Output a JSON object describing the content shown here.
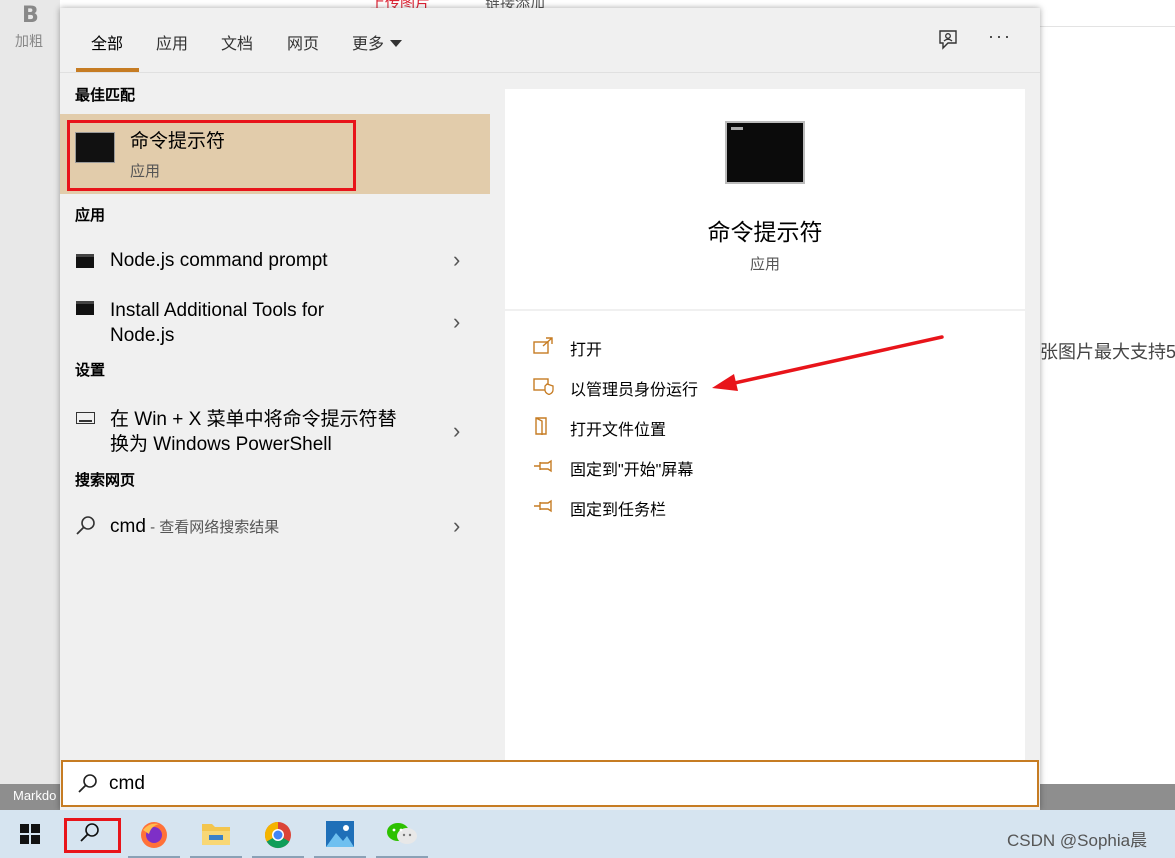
{
  "background": {
    "bold_icon_char": "B",
    "bold_label": "加粗",
    "upload_label": "上传图片",
    "link_label": "链接添加",
    "side_text": "张图片最大支持5",
    "status_text": "Markdo"
  },
  "tabs": {
    "all": "全部",
    "apps": "应用",
    "docs": "文档",
    "web": "网页",
    "more": "更多"
  },
  "sections": {
    "best_match": "最佳匹配",
    "apps": "应用",
    "settings": "设置",
    "web_search": "搜索网页"
  },
  "best_match": {
    "name": "命令提示符",
    "type": "应用"
  },
  "apps": [
    {
      "line1": "Node.js command prompt"
    },
    {
      "line1": "Install Additional Tools for",
      "line2": "Node.js"
    }
  ],
  "settings": [
    {
      "line1": "在 Win + X 菜单中将命令提示符替",
      "line2": "换为 Windows PowerShell"
    }
  ],
  "web": {
    "query": "cmd",
    "sub": " - 查看网络搜索结果"
  },
  "detail": {
    "name": "命令提示符",
    "type": "应用",
    "actions": [
      "打开",
      "以管理员身份运行",
      "打开文件位置",
      "固定到\"开始\"屏幕",
      "固定到任务栏"
    ]
  },
  "search": {
    "value": "cmd"
  },
  "watermark": "CSDN @Sophia晨",
  "colors": {
    "accent": "#c67c23",
    "highlight": "#e2ccab",
    "annotation_red": "#e8141a"
  }
}
